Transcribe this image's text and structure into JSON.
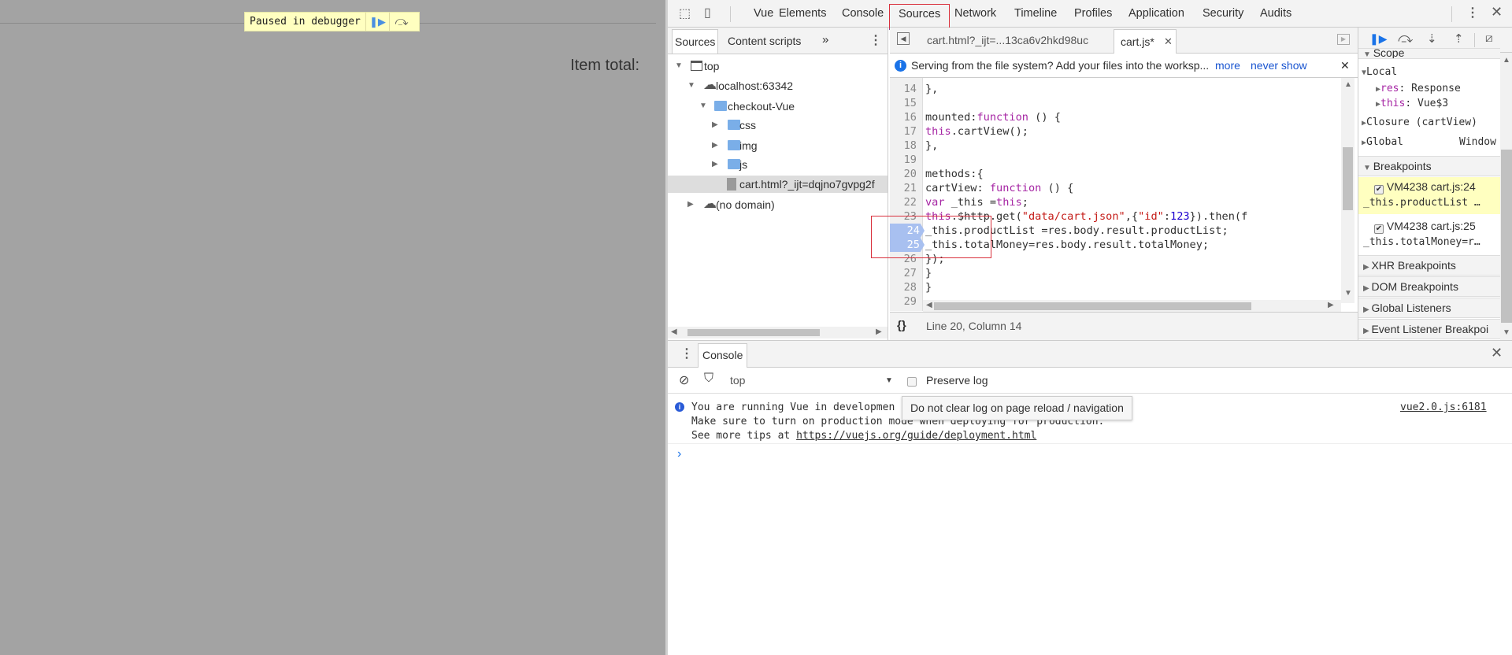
{
  "page": {
    "paused_label": "Paused in debugger",
    "item_total": "Item total:"
  },
  "toolbar": {
    "tabs": [
      "Vue",
      "Elements",
      "Console",
      "Sources",
      "Network",
      "Timeline",
      "Profiles",
      "Application",
      "Security",
      "Audits"
    ],
    "active": "Sources"
  },
  "navigator": {
    "tabs": [
      "Sources",
      "Content scripts"
    ],
    "more": "»",
    "tree": [
      {
        "label": "top"
      },
      {
        "label": "localhost:63342"
      },
      {
        "label": "checkout-Vue"
      },
      {
        "label": "css"
      },
      {
        "label": "img"
      },
      {
        "label": "js"
      },
      {
        "label": "cart.html?_ijt=dqjno7gvpg2f"
      },
      {
        "label": "(no domain)"
      }
    ]
  },
  "editor": {
    "tabs": [
      {
        "label": "cart.html?_ijt=...13ca6v2hkd98uc"
      },
      {
        "label": "cart.js*"
      }
    ],
    "infobar": {
      "text": "Serving from the file system? Add your files into the worksp...",
      "more": "more",
      "never_show": "never show"
    },
    "lines": [
      {
        "n": "14",
        "tokens": [
          [
            "    },",
            ""
          ]
        ]
      },
      {
        "n": "15",
        "tokens": []
      },
      {
        "n": "16",
        "tokens": [
          [
            "       mounted:",
            ""
          ],
          [
            "function",
            "kw"
          ],
          [
            " () {",
            ""
          ]
        ]
      },
      {
        "n": "17",
        "tokens": [
          [
            "         ",
            ""
          ],
          [
            "this",
            "kw"
          ],
          [
            ".cartView();",
            ""
          ]
        ]
      },
      {
        "n": "18",
        "tokens": [
          [
            "    },",
            ""
          ]
        ]
      },
      {
        "n": "19",
        "tokens": []
      },
      {
        "n": "20",
        "tokens": [
          [
            "    methods:{",
            ""
          ]
        ]
      },
      {
        "n": "21",
        "tokens": [
          [
            "      cartView: ",
            ""
          ],
          [
            "function",
            "kw"
          ],
          [
            " () {",
            ""
          ]
        ]
      },
      {
        "n": "22",
        "tokens": [
          [
            "             ",
            ""
          ],
          [
            "var",
            "kw"
          ],
          [
            " _this =",
            ""
          ],
          [
            "this",
            "kw"
          ],
          [
            ";",
            ""
          ]
        ]
      },
      {
        "n": "23",
        "tokens": [
          [
            "              ",
            ""
          ],
          [
            "this",
            "kw"
          ],
          [
            ".$http.get(",
            ""
          ],
          [
            "\"data/cart.json\"",
            "str"
          ],
          [
            ",{",
            ""
          ],
          [
            "\"id\"",
            "str"
          ],
          [
            ":",
            ""
          ],
          [
            "123",
            "num"
          ],
          [
            "}).then(f",
            ""
          ]
        ]
      },
      {
        "n": "24",
        "bp": true,
        "tokens": [
          [
            "             _this.productList =res.body.result.productList;",
            ""
          ]
        ]
      },
      {
        "n": "25",
        "bp": true,
        "tokens": [
          [
            "             _this.totalMoney=res.body.result.totalMoney;",
            ""
          ]
        ]
      },
      {
        "n": "26",
        "tokens": [
          [
            "          });",
            ""
          ]
        ]
      },
      {
        "n": "27",
        "tokens": [
          [
            "      }",
            ""
          ]
        ]
      },
      {
        "n": "28",
        "tokens": [
          [
            "    }",
            ""
          ]
        ]
      },
      {
        "n": "29",
        "tokens": []
      }
    ],
    "status": "Line 20, Column 14",
    "format_icon": "{}"
  },
  "debugger": {
    "scope_header": "Scope",
    "local": "Local",
    "vars": [
      {
        "name": "res",
        "value": "Response"
      },
      {
        "name": "this",
        "value": "Vue$3"
      }
    ],
    "closure": "Closure (cartView)",
    "global": "Global",
    "global_value": "Window",
    "breakpoints_header": "Breakpoints",
    "breakpoints": [
      {
        "location": "VM4238 cart.js:24",
        "code": "_this.productList …",
        "checked": true,
        "active": true
      },
      {
        "location": "VM4238 cart.js:25",
        "code": "_this.totalMoney=r…",
        "checked": true,
        "active": false
      }
    ],
    "sections": [
      "XHR Breakpoints",
      "DOM Breakpoints",
      "Global Listeners",
      "Event Listener Breakpoi"
    ]
  },
  "console": {
    "tab": "Console",
    "context": "top",
    "preserve_log": "Preserve log",
    "tooltip": "Do not clear log on page reload / navigation",
    "message": {
      "line1": "You are running Vue in developmen",
      "line2": "Make sure to turn on production mode when deploying for production.",
      "line3_prefix": "See more tips at ",
      "link": "https://vuejs.org/guide/deployment.html",
      "source": "vue2.0.js:6181"
    },
    "prompt": "›"
  },
  "colors": {
    "accent": "#1a73e8",
    "breakpoint": "#a8c0f0",
    "highlight": "#ffffc0",
    "annotation": "#d9303c"
  }
}
